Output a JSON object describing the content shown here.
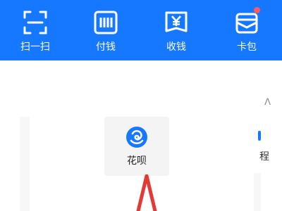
{
  "topbar": {
    "bg": "#1677ff",
    "actions": [
      {
        "label": "扫一扫",
        "icon": "scan-icon"
      },
      {
        "label": "付钱",
        "icon": "barcode-pay-icon"
      },
      {
        "label": "收钱",
        "icon": "yuan-receive-icon"
      },
      {
        "label": "卡包",
        "icon": "wallet-card-icon",
        "badge": true
      }
    ]
  },
  "tile": {
    "label": "花呗",
    "icon": "huabei-icon",
    "icon_color": "#1677ff"
  },
  "side": {
    "right_label": "程"
  },
  "pointer": {
    "color": "#e53935"
  }
}
